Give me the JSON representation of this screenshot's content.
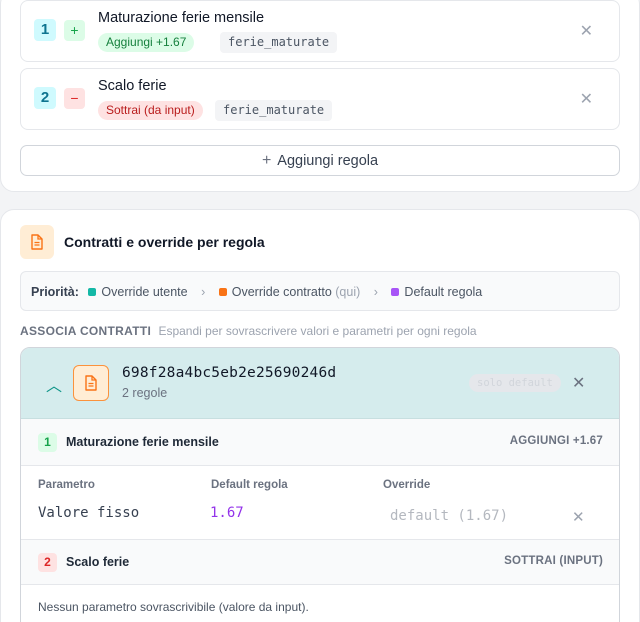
{
  "rules_panel": {
    "rules": [
      {
        "number": "1",
        "sign": "+",
        "name": "Maturazione ferie mensile",
        "badge": "Aggiungi +1.67",
        "variable": "ferie_maturate"
      },
      {
        "number": "2",
        "sign": "−",
        "name": "Scalo ferie",
        "badge": "Sottrai (da input)",
        "variable": "ferie_maturate"
      }
    ],
    "add_rule_label": "Aggiungi regola"
  },
  "contracts_panel": {
    "title": "Contratti e override per regola",
    "priority": {
      "label": "Priorità:",
      "user_override": "Override utente",
      "contract_override": "Override contratto",
      "contract_override_note": "(qui)",
      "rule_default": "Default regola"
    },
    "associate": {
      "label": "ASSOCIA CONTRATTI",
      "hint": "Espandi per sovrascrivere valori e parametri per ogni regola"
    },
    "contract": {
      "id": "698f28a4bc5eb2e25690246d",
      "count": "2 regole",
      "badge": "solo default",
      "rules": [
        {
          "number": "1",
          "name": "Maturazione ferie mensile",
          "action": "AGGIUNGI +1.67",
          "columns": [
            "Parametro",
            "Default regola",
            "Override"
          ],
          "param_name": "Valore fisso",
          "default_value": "1.67",
          "override_placeholder": "default (1.67)"
        },
        {
          "number": "2",
          "name": "Scalo ferie",
          "action": "SOTTRAI (INPUT)",
          "note": "Nessun parametro sovrascrivibile (valore da input)."
        }
      ]
    }
  },
  "colors": {
    "accent_teal": "#14b8a6",
    "accent_orange": "#f97316",
    "accent_purple": "#a855f7",
    "default_value": "#9333ea"
  },
  "icons": [
    "close-icon",
    "plus-icon",
    "document-icon",
    "chevron-up-icon",
    "chevron-right-icon"
  ]
}
